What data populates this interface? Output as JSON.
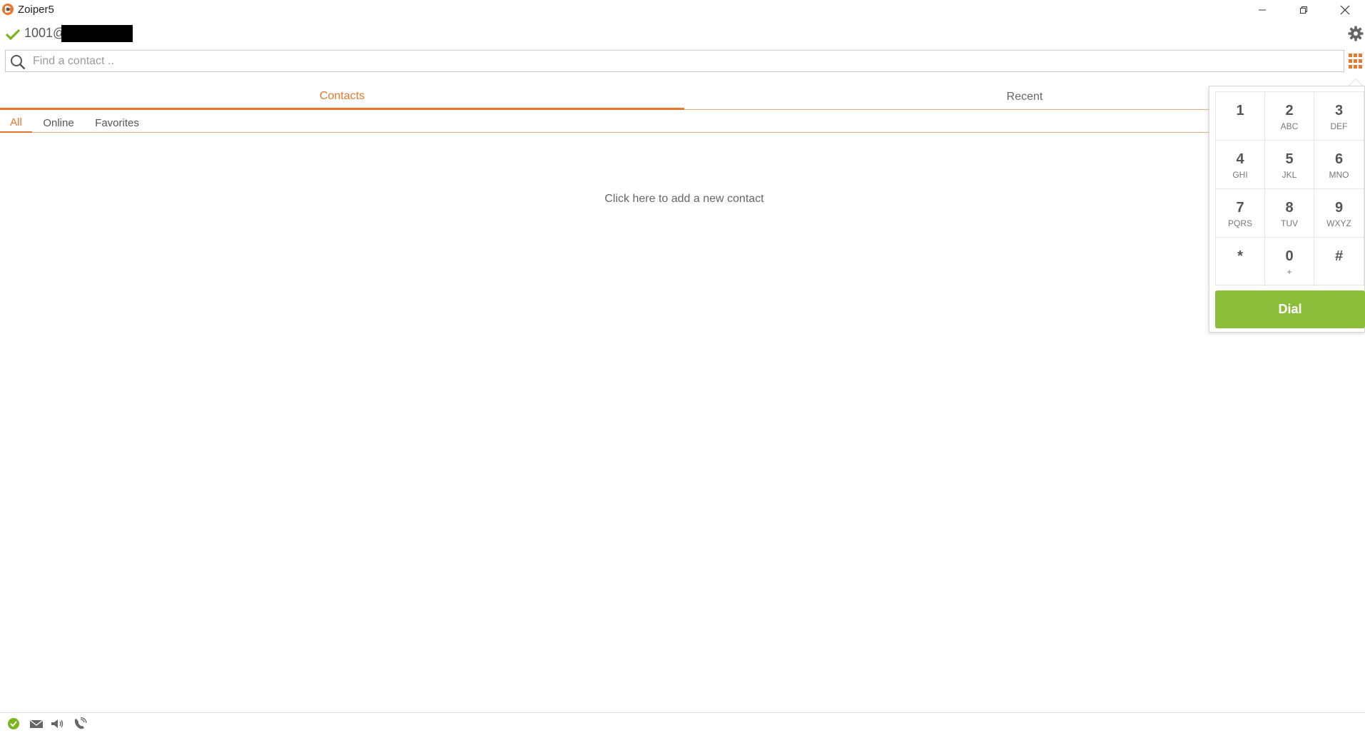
{
  "window": {
    "title": "Zoiper5",
    "minimize_label": "—",
    "maximize_label": "❐",
    "close_label": "✕"
  },
  "account": {
    "name": "1001@",
    "status": "registered"
  },
  "search": {
    "placeholder": "Find a contact .."
  },
  "main_tabs": [
    {
      "label": "Contacts",
      "active": true
    },
    {
      "label": "Recent",
      "active": false
    }
  ],
  "sub_tabs": [
    {
      "label": "All",
      "active": true
    },
    {
      "label": "Online",
      "active": false
    },
    {
      "label": "Favorites",
      "active": false
    }
  ],
  "empty_state": {
    "add_contact_label": "Click here to add a new contact"
  },
  "dialpad": {
    "keys": [
      {
        "digit": "1",
        "letters": ""
      },
      {
        "digit": "2",
        "letters": "ABC"
      },
      {
        "digit": "3",
        "letters": "DEF"
      },
      {
        "digit": "4",
        "letters": "GHI"
      },
      {
        "digit": "5",
        "letters": "JKL"
      },
      {
        "digit": "6",
        "letters": "MNO"
      },
      {
        "digit": "7",
        "letters": "PQRS"
      },
      {
        "digit": "8",
        "letters": "TUV"
      },
      {
        "digit": "9",
        "letters": "WXYZ"
      },
      {
        "digit": "*",
        "letters": ""
      },
      {
        "digit": "0",
        "letters": "+"
      },
      {
        "digit": "#",
        "letters": ""
      }
    ],
    "dial_label": "Dial"
  },
  "colors": {
    "accent": "#e8762b",
    "dial_green": "#8cbd3a",
    "status_green": "#7ab51d"
  },
  "status_icons": [
    "online-status-icon",
    "mail-icon",
    "speaker-icon",
    "phone-icon"
  ]
}
